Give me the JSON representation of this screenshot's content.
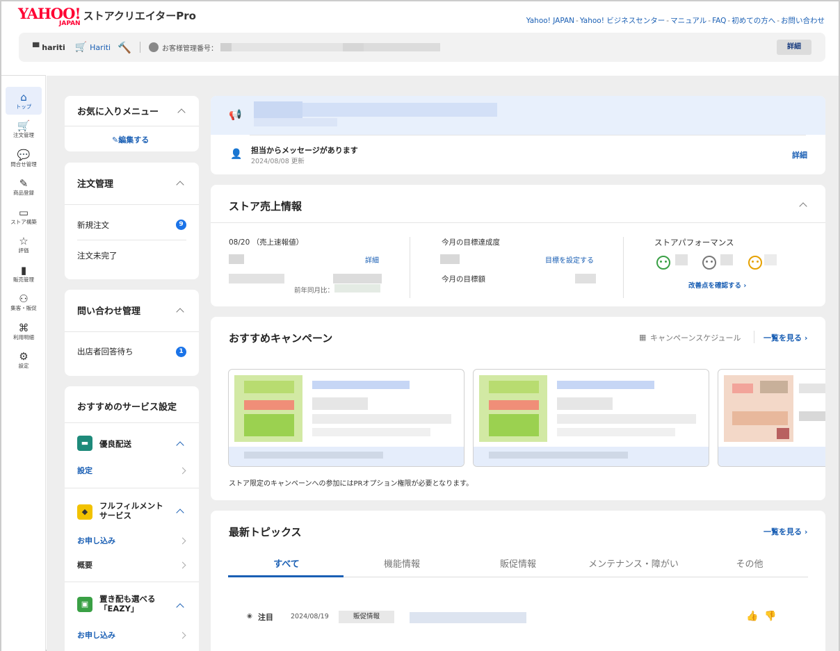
{
  "header": {
    "logo_yahoo": "YAHOO!",
    "logo_japan": "JAPAN",
    "product_name": "ストアクリエイターPro",
    "top_links": [
      "Yahoo! JAPAN",
      "Yahoo! ビジネスセンター",
      "マニュアル",
      "FAQ",
      "初めての方へ",
      "お問い合わせ"
    ],
    "separator": "-",
    "store_id": "hariti",
    "store_link": "Hariti",
    "account_label": "お客様管理番号：",
    "detail_button": "詳細"
  },
  "rail": {
    "items": [
      {
        "label": "トップ",
        "icon": "home-icon",
        "glyph": "⌂",
        "active": true
      },
      {
        "label": "注文管理",
        "icon": "cart-icon",
        "glyph": "🛒",
        "active": false
      },
      {
        "label": "問合せ管理",
        "icon": "chat-icon",
        "glyph": "💬",
        "active": false
      },
      {
        "label": "商品登録",
        "icon": "edit-icon",
        "glyph": "✎",
        "active": false
      },
      {
        "label": "ストア構築",
        "icon": "store-icon",
        "glyph": "▭",
        "active": false
      },
      {
        "label": "評価",
        "icon": "star-icon",
        "glyph": "☆",
        "active": false
      },
      {
        "label": "販売管理",
        "icon": "bar-chart-icon",
        "glyph": "▮",
        "active": false
      },
      {
        "label": "集客・販促",
        "icon": "people-icon",
        "glyph": "⚇",
        "active": false
      },
      {
        "label": "利用明細",
        "icon": "receipt-icon",
        "glyph": "⌘",
        "active": false
      },
      {
        "label": "設定",
        "icon": "gear-icon",
        "glyph": "⚙",
        "active": false
      }
    ]
  },
  "favorites": {
    "title": "お気に入りメニュー",
    "edit_label": "編集する"
  },
  "orders": {
    "title": "注文管理",
    "items": [
      {
        "label": "新規注文",
        "count": "9"
      },
      {
        "label": "注文未完了",
        "count": ""
      }
    ]
  },
  "inquiries": {
    "title": "問い合わせ管理",
    "items": [
      {
        "label": "出店者回答待ち",
        "count": "1"
      }
    ]
  },
  "services": {
    "title": "おすすめのサービス設定",
    "items": [
      {
        "name": "優良配送",
        "links": [
          "設定"
        ],
        "color": "#1e8a7a"
      },
      {
        "name": "フルフィルメント\nサービス",
        "links": [
          "お申し込み",
          "概要"
        ],
        "color": "#f2c200"
      },
      {
        "name": "置き配も選べる\n「EAZY」",
        "links": [
          "お申し込み"
        ],
        "color": "#3aa045"
      }
    ]
  },
  "notice": {
    "message_title": "担当からメッセージがあります",
    "message_date": "2024/08/08 更新",
    "detail_link": "詳細"
  },
  "sales": {
    "title": "ストア売上情報",
    "date_label": "08/20 （売上速報値）",
    "detail_link": "詳細",
    "yoy_label": "前年同月比：",
    "target_title": "今月の目標達成度",
    "set_target_link": "目標を設定する",
    "target_amount_label": "今月の目標額",
    "performance_title": "ストアパフォーマンス",
    "improve_link": "改善点を確認する"
  },
  "campaigns": {
    "title": "おすすめキャンペーン",
    "schedule_label": "キャンペーンスケジュール",
    "view_all": "一覧を見る",
    "note": "ストア限定のキャンペーンへの参加にはPRオプション権限が必要となります。"
  },
  "topics": {
    "title": "最新トピックス",
    "view_all": "一覧を見る",
    "tabs": [
      "すべて",
      "機能情報",
      "販促情報",
      "メンテナンス・障がい",
      "その他"
    ],
    "active_tab": "すべて",
    "rows": [
      {
        "flag": "注目",
        "date": "2024/08/19",
        "category": "販促情報"
      }
    ]
  },
  "colors": {
    "accent": "#1a5fb4",
    "brand_red": "#ff0033",
    "badge_blue": "#1a73e8",
    "face_good": "#3aa045",
    "face_neutral": "#777777",
    "face_bad": "#e6a100"
  }
}
